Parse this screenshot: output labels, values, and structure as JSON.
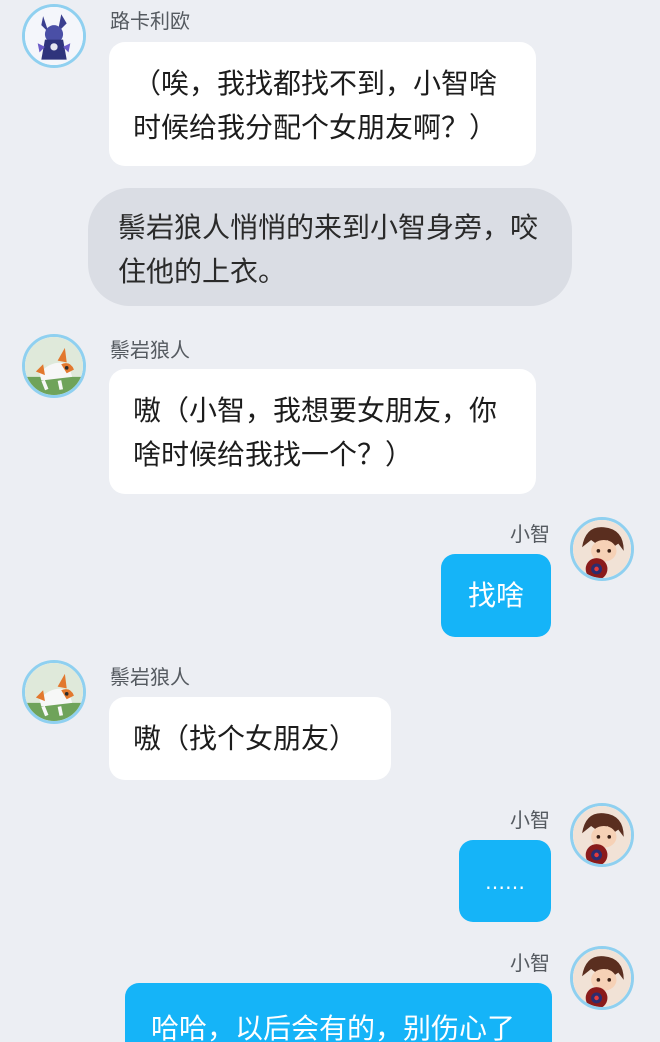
{
  "messages": [
    {
      "sender": "路卡利欧",
      "avatar_icon": "lucario-avatar-icon",
      "text": "（唉，我找都找不到，小智啥时候给我分配个女朋友啊？）"
    },
    {
      "narration": "鬃岩狼人悄悄的来到小智身旁，咬住他的上衣。"
    },
    {
      "sender": "鬃岩狼人",
      "avatar_icon": "lycanroc-avatar-icon",
      "text": "嗷（小智，我想要女朋友，你啥时候给我找一个？）"
    },
    {
      "sender": "小智",
      "avatar_icon": "ash-avatar-icon",
      "text": "找啥"
    },
    {
      "sender": "鬃岩狼人",
      "avatar_icon": "lycanroc-avatar-icon",
      "text": "嗷（找个女朋友）"
    },
    {
      "sender": "小智",
      "avatar_icon": "ash-avatar-icon",
      "text": "……"
    },
    {
      "sender": "小智",
      "avatar_icon": "ash-avatar-icon",
      "text": "哈哈，以后会有的，别伤心了"
    }
  ],
  "colors": {
    "background": "#eceef3",
    "bubble_in": "#ffffff",
    "bubble_out": "#15b4f8",
    "narration": "#dadde4",
    "avatar_ring": "#8fd0f0"
  }
}
